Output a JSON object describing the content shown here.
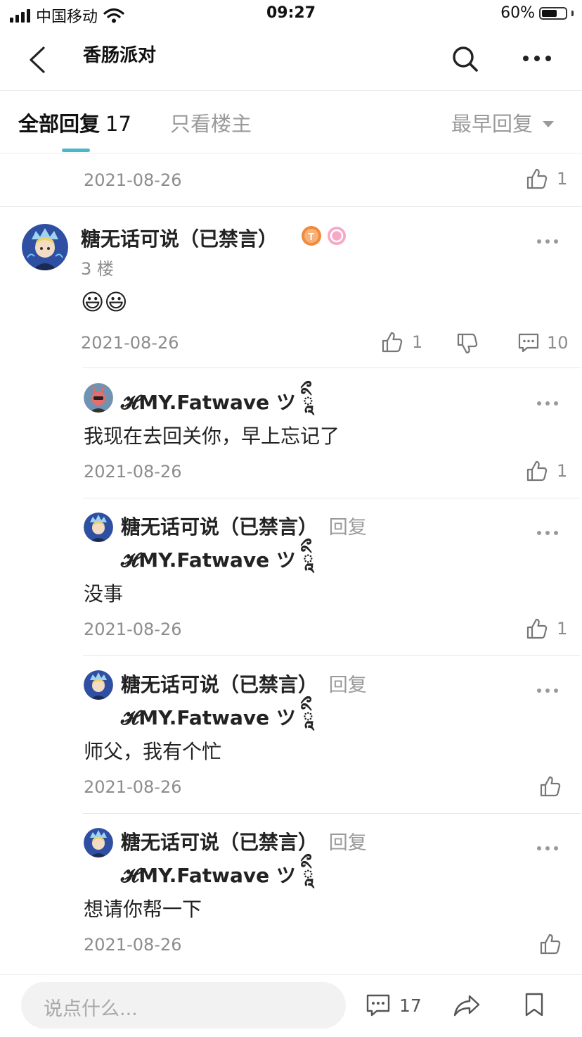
{
  "status_bar": {
    "carrier": "中国移动",
    "time": "09:27",
    "battery": "60%"
  },
  "header": {
    "title": "香肠派对"
  },
  "tabs": {
    "all_label": "全部回复",
    "all_count": "17",
    "op_only": "只看楼主",
    "sort": "最早回复"
  },
  "prev_post": {
    "date": "2021-08-26",
    "likes": "1"
  },
  "post": {
    "author": "糖无话可说（已禁言）",
    "floor": "3 楼",
    "content": "😃😃",
    "date": "2021-08-26",
    "likes": "1",
    "comments": "10"
  },
  "replies": [
    {
      "author": "𝓗MY.Fatwave ツ ཱིྀ",
      "content": "我现在去回关你，早上忘记了",
      "date": "2021-08-26",
      "likes": "1"
    },
    {
      "author": "糖无话可说（已禁言）",
      "reply_word": "回复",
      "reply_to": "𝓗MY.Fatwave ツ ཱིྀ",
      "content": "没事",
      "date": "2021-08-26",
      "likes": "1"
    },
    {
      "author": "糖无话可说（已禁言）",
      "reply_word": "回复",
      "reply_to": "𝓗MY.Fatwave ツ ཱིྀ",
      "content": "师父，我有个忙",
      "date": "2021-08-26",
      "likes": ""
    },
    {
      "author": "糖无话可说（已禁言）",
      "reply_word": "回复",
      "reply_to": "𝓗MY.Fatwave ツ ཱིྀ",
      "content": "想请你帮一下",
      "date": "2021-08-26",
      "likes": ""
    }
  ],
  "bottom": {
    "placeholder": "说点什么...",
    "comment_count": "17"
  },
  "colors": {
    "accent": "#4ab7c8",
    "muted": "#8c8c8c"
  }
}
